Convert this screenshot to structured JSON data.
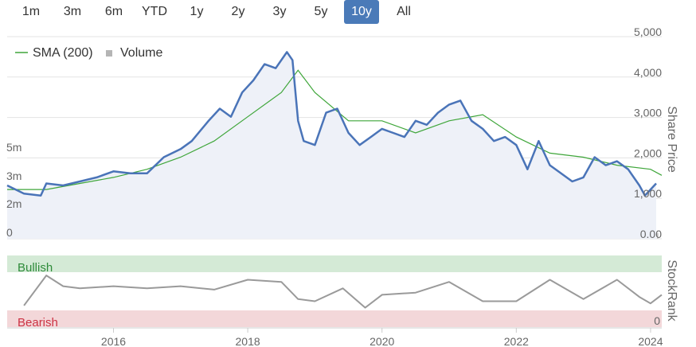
{
  "range_selector": {
    "buttons": [
      "1m",
      "3m",
      "6m",
      "YTD",
      "1y",
      "2y",
      "3y",
      "5y",
      "10y",
      "All"
    ],
    "active": "10y"
  },
  "colors": {
    "price": "#4a74b8",
    "sma": "#3fa63a",
    "volume": "#c4c4c4",
    "stockrank": "#9a9a9a",
    "bullish_fill": "#d4ead6",
    "bearish_fill": "#f3d7d9",
    "bullish_text": "#2e8b3a",
    "bearish_text": "#cc3344",
    "active_button": "#4a7ab8"
  },
  "chart_data": [
    {
      "type": "line",
      "legend": [
        "SMA (200)",
        "Volume"
      ],
      "ylabel": "Share Price",
      "yticks": [
        "5,000",
        "4,000",
        "3,000",
        "2,000",
        "1,000",
        "0.00"
      ],
      "ylim": [
        0,
        5000
      ],
      "volume_ticks": [
        "5m",
        "3m",
        "2m",
        "0"
      ],
      "xticks": [
        "2016",
        "2018",
        "2020",
        "2022",
        "2024"
      ],
      "xlim": [
        "2014-06",
        "2024-03"
      ],
      "series": [
        {
          "name": "Share Price",
          "x": [
            "2014-06",
            "2014-09",
            "2014-12",
            "2015-01",
            "2015-04",
            "2015-07",
            "2015-10",
            "2016-01",
            "2016-04",
            "2016-07",
            "2016-10",
            "2017-01",
            "2017-03",
            "2017-06",
            "2017-08",
            "2017-10",
            "2017-12",
            "2018-02",
            "2018-04",
            "2018-06",
            "2018-08",
            "2018-09",
            "2018-10",
            "2018-11",
            "2019-01",
            "2019-03",
            "2019-05",
            "2019-07",
            "2019-09",
            "2019-11",
            "2020-01",
            "2020-03",
            "2020-05",
            "2020-07",
            "2020-09",
            "2020-11",
            "2021-01",
            "2021-03",
            "2021-05",
            "2021-07",
            "2021-09",
            "2021-11",
            "2022-01",
            "2022-03",
            "2022-05",
            "2022-07",
            "2022-09",
            "2022-11",
            "2023-01",
            "2023-03",
            "2023-05",
            "2023-07",
            "2023-09",
            "2023-11",
            "2023-12",
            "2024-01",
            "2024-02"
          ],
          "values": [
            1200,
            1000,
            950,
            1250,
            1200,
            1300,
            1400,
            1550,
            1500,
            1500,
            1900,
            2100,
            2300,
            2800,
            3100,
            2900,
            3500,
            3800,
            4200,
            4100,
            4500,
            4300,
            2800,
            2300,
            2200,
            3000,
            3100,
            2500,
            2200,
            2400,
            2600,
            2500,
            2400,
            2800,
            2700,
            3000,
            3200,
            3300,
            2800,
            2600,
            2300,
            2400,
            2200,
            1600,
            2300,
            1700,
            1500,
            1300,
            1400,
            1900,
            1700,
            1800,
            1600,
            1200,
            950,
            1100,
            1250
          ]
        },
        {
          "name": "SMA (200)",
          "x": [
            "2014-06",
            "2015-01",
            "2015-07",
            "2016-01",
            "2016-07",
            "2017-01",
            "2017-07",
            "2018-01",
            "2018-07",
            "2018-10",
            "2019-01",
            "2019-07",
            "2020-01",
            "2020-07",
            "2021-01",
            "2021-07",
            "2022-01",
            "2022-07",
            "2023-01",
            "2023-07",
            "2024-01",
            "2024-03"
          ],
          "values": [
            1100,
            1100,
            1250,
            1400,
            1600,
            1900,
            2300,
            2900,
            3500,
            4050,
            3500,
            2800,
            2800,
            2500,
            2800,
            2950,
            2400,
            2000,
            1900,
            1700,
            1600,
            1450
          ]
        }
      ]
    },
    {
      "type": "line",
      "ylabel": "StockRank",
      "yticks": [
        "0"
      ],
      "ylim": [
        0,
        100
      ],
      "zones": [
        "Bullish",
        "Bearish"
      ],
      "series": [
        {
          "name": "StockRank",
          "x": [
            "2014-09",
            "2015-01",
            "2015-04",
            "2015-07",
            "2016-01",
            "2016-07",
            "2017-01",
            "2017-07",
            "2018-01",
            "2018-07",
            "2018-10",
            "2019-01",
            "2019-06",
            "2019-10",
            "2020-01",
            "2020-07",
            "2021-01",
            "2021-07",
            "2022-01",
            "2022-07",
            "2023-01",
            "2023-07",
            "2023-11",
            "2024-01",
            "2024-03"
          ],
          "values": [
            15,
            85,
            60,
            55,
            60,
            55,
            60,
            52,
            75,
            70,
            30,
            25,
            55,
            10,
            40,
            45,
            70,
            25,
            25,
            75,
            30,
            75,
            35,
            20,
            40
          ]
        }
      ]
    }
  ]
}
